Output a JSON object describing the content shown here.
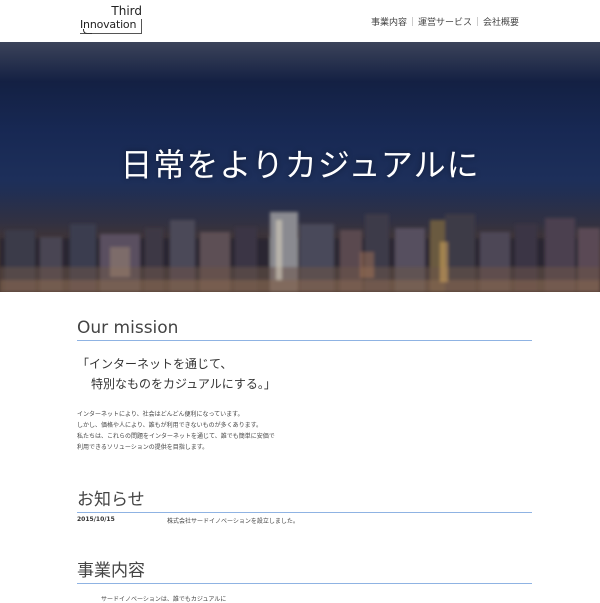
{
  "header": {
    "logo_line1": "Third",
    "logo_line2": "Innovation",
    "nav": [
      "事業内容",
      "運営サービス",
      "会社概要"
    ]
  },
  "hero": {
    "tagline": "日常をよりカジュアルに"
  },
  "mission": {
    "heading": "Our mission",
    "catch_line1": "「インターネットを通じて、",
    "catch_line2": "特別なものをカジュアルにする。」",
    "body": [
      "インターネットにより、社会はどんどん便利になっています。",
      "しかし、価格や人により、誰もが利用できないものが多くあります。",
      "私たちは、これらの問題をインターネットを通じて、誰でも簡単に安価で",
      "利用できるソリューションの提供を目指します。"
    ]
  },
  "news": {
    "heading": "お知らせ",
    "items": [
      {
        "date": "2015/10/15",
        "text": "株式会社サードイノベーションを設立しました。"
      }
    ]
  },
  "business": {
    "heading": "事業内容",
    "text": "サードイノベーションは、誰でもカジュアルに"
  },
  "colors": {
    "accent_line": "#8fb3e3",
    "hero_sky": "#172853"
  }
}
